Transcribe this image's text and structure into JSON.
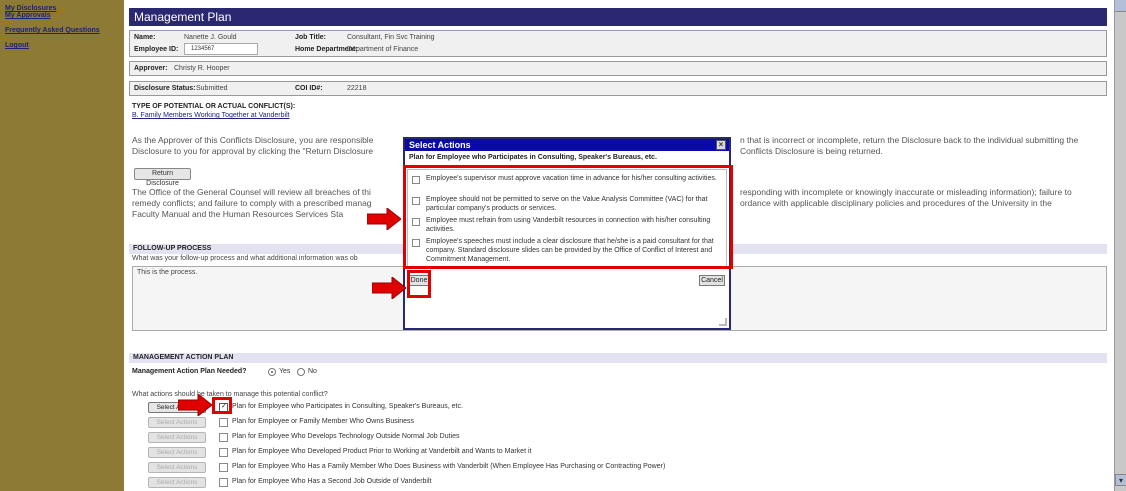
{
  "sidebar": {
    "links": [
      "My Disclosures",
      "My Approvals",
      "Frequently Asked Questions",
      "Logout"
    ]
  },
  "header": {
    "title": "Management Plan"
  },
  "employee": {
    "name_label": "Name:",
    "name": "Nanette J. Gould",
    "id_label": "Employee ID:",
    "id": "1234567",
    "job_title_label": "Job Title:",
    "job_title": "Consultant, Fin Svc Training",
    "dept_label": "Home Department:",
    "dept": "Department of Finance"
  },
  "approver": {
    "label": "Approver:",
    "value": "Christy R. Hooper"
  },
  "status": {
    "label": "Disclosure Status:",
    "value": "Submitted",
    "coi_label": "COI ID#:",
    "coi": "22218"
  },
  "conflict": {
    "heading": "TYPE OF POTENTIAL OR ACTUAL CONFLICT(S):",
    "type_link": "B. Family Members Working Together at Vanderbilt"
  },
  "para1": {
    "left": "As the Approver of this Conflicts Disclosure, you are responsible",
    "right": "n that is incorrect or incomplete, return the Disclosure back to the individual submitting the",
    "line2_left": "Disclosure to you for approval by clicking the \"Return Disclosure",
    "line2_right": "Conflicts Disclosure is being returned."
  },
  "return_button": "Return Disclosure",
  "para2": {
    "line1_left": "The Office of the General Counsel will review all breaches of thi",
    "line1_right": "responding with incomplete or knowingly inaccurate or misleading information); failure to",
    "line2_left": "remedy conflicts; and failure to comply with a prescribed manag",
    "line2_right": "ordance with applicable disciplinary policies and procedures of the University in the",
    "line3_left": "Faculty Manual and the Human Resources Services Sta"
  },
  "followup": {
    "heading": "FOLLOW-UP PROCESS",
    "question": "What was your follow-up process and what additional information was ob",
    "answer": "This is the process."
  },
  "action_plan": {
    "heading": "MANAGEMENT ACTION PLAN",
    "needed_label": "Management Action Plan Needed?",
    "yes": "Yes",
    "no": "No",
    "question": "What actions should be taken to manage this potential conflict?",
    "select_label": "Select Actions",
    "rows": [
      "Plan for Employee who Participates in Consulting, Speaker's Bureaus, etc.",
      "Plan for Employee or Family Member Who Owns Business",
      "Plan for Employee Who Develops Technology Outside Normal Job Duties",
      "Plan for Employee Who Developed Product Prior to Working at Vanderbilt and Wants to Market it",
      "Plan for Employee Who Has a Family Member Who Does Business with Vanderbilt (When Employee Has Purchasing or Contracting Power)",
      "Plan for Employee Who Has a Second Job Outside of Vanderbilt"
    ]
  },
  "modal": {
    "title": "Select Actions",
    "close": "×",
    "subtitle": "Plan for Employee who Participates in Consulting, Speaker's Bureaus, etc.",
    "options": [
      "Employee's supervisor must approve vacation time in advance for his/her consulting activities.",
      "Employee should not be permitted to serve on the Value Analysis Committee (VAC) for that particular company's products or services.",
      "Employee must refrain from using Vanderbilt resources in connection with his/her consulting activities.",
      "Employee's speeches must include a clear disclosure that he/she is a paid consultant for that company. Standard disclosure slides can be provided by the Office of Conflict of Interest and Commitment Management."
    ],
    "done": "Done",
    "cancel": "Cancel"
  },
  "colors": {
    "sidebar": "#8c7a35",
    "header": "#2a2870",
    "modal_header": "#0a0aa8",
    "annotation": "#e00000"
  }
}
